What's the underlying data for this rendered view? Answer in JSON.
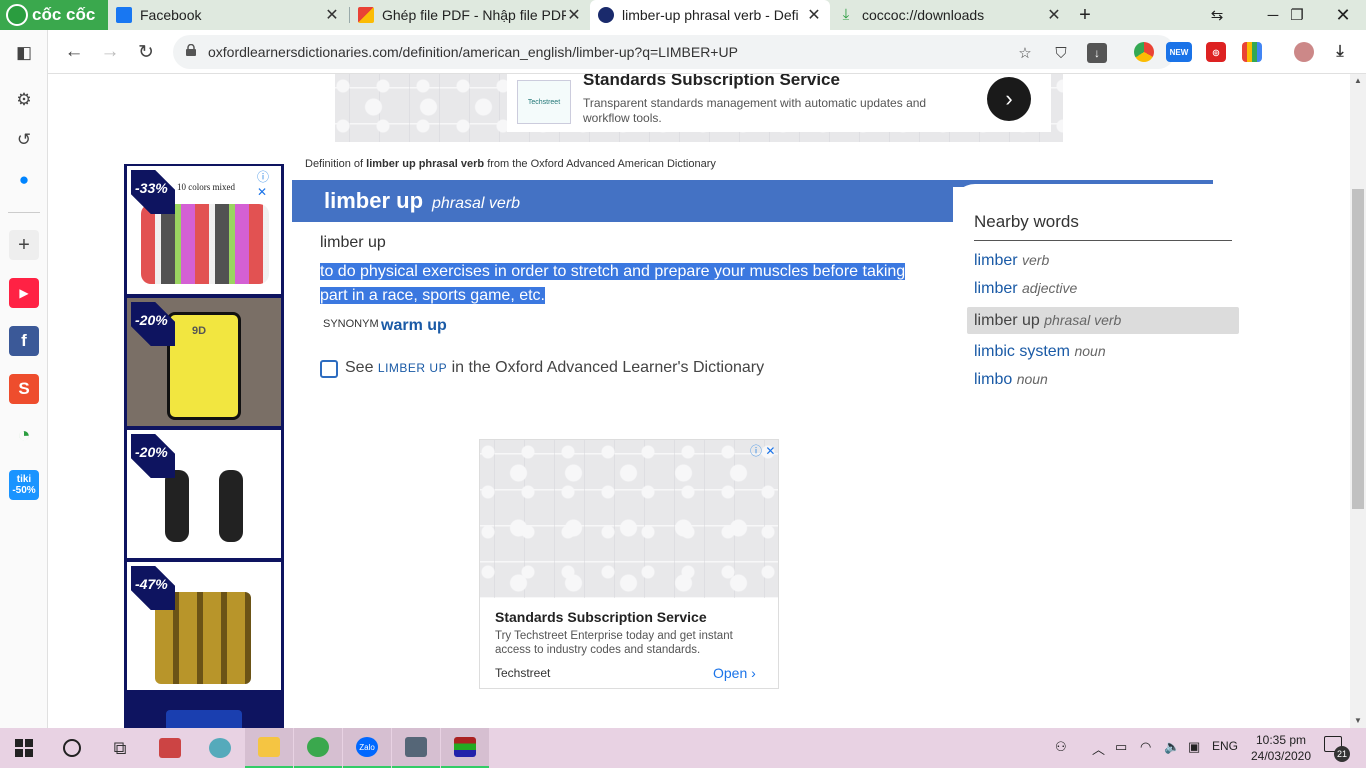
{
  "browser": {
    "brand": "cốc cốc",
    "tabs": [
      {
        "title": "Facebook",
        "color": "#1877f2"
      },
      {
        "title": "Ghép file PDF - Nhập file PDF",
        "color": "#e94235"
      },
      {
        "title": "limber-up phrasal verb - Defi",
        "color": "#1a2a6c"
      },
      {
        "title": "coccoc://downloads",
        "color": "#2a9d3f"
      }
    ],
    "url": "oxfordlearnersdictionaries.com/definition/american_english/limber-up?q=LIMBER+UP",
    "new_badge": "NEW"
  },
  "sidebar": {
    "tiki_label": "tiki",
    "tiki_discount": "-50%"
  },
  "top_ad": {
    "title": "Standards Subscription Service",
    "desc": "Transparent standards management with automatic updates and workflow tools.",
    "logo": "Techstreet"
  },
  "left_ad": {
    "items": [
      {
        "discount": "-33%",
        "caption": "10 colors mixed"
      },
      {
        "discount": "-20%",
        "caption": "9D"
      },
      {
        "discount": "-20%",
        "caption": ""
      },
      {
        "discount": "-47%",
        "caption": ""
      }
    ]
  },
  "entry": {
    "source_prefix": "Definition of",
    "source_word": "limber up phrasal verb",
    "source_suffix": "from the Oxford Advanced American Dictionary",
    "headword": "limber up",
    "pos": "phrasal verb",
    "subhead": "limber up",
    "definition": "to do physical exercises in order to stretch and prepare your muscles before taking part in a race, sports game, etc.",
    "synonym_label": "SYNONYM",
    "synonym": "warm up",
    "see_prefix": "See",
    "see_word": "limber up",
    "see_suffix": "in the Oxford Advanced Learner's Dictionary"
  },
  "nearby": {
    "title": "Nearby words",
    "items": [
      {
        "word": "limber",
        "pos": "verb"
      },
      {
        "word": "limber",
        "pos": "adjective"
      },
      {
        "word": "limber up",
        "pos": "phrasal verb"
      },
      {
        "word": "limbic system",
        "pos": "noun"
      },
      {
        "word": "limbo",
        "pos": "noun"
      }
    ]
  },
  "mid_ad": {
    "title": "Standards Subscription Service",
    "desc": "Try Techstreet Enterprise today and get instant access to industry codes and standards.",
    "source": "Techstreet",
    "open": "Open"
  },
  "taskbar": {
    "lang": "ENG",
    "time": "10:35 pm",
    "date": "24/03/2020",
    "notifications": "21",
    "zalo": "Zalo"
  }
}
